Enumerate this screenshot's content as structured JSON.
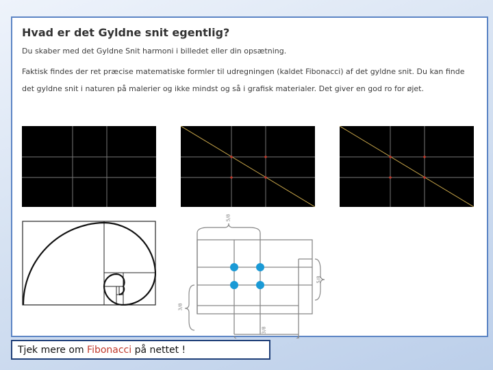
{
  "slide": {
    "heading": "Hvad er det Gyldne snit egentlig?",
    "paragraph_1": "Du skaber med det Gyldne Snit harmoni i billedet eller din opsætning.",
    "paragraph_2": "Faktisk findes der ret præcise matematiske formler til udregningen (kaldet Fibonacci) af det gyldne snit. Du kan finde det gyldne snit i naturen på malerier og ikke mindst og så i grafisk materialer. Det giver en god ro for øjet.",
    "diagram_labels": {
      "top": "5/8",
      "right": "5/8",
      "left": "3/8",
      "bottom": "3/8"
    }
  },
  "caption": {
    "prefix": "Tjek mere om ",
    "link": "Fibonacci",
    "suffix": " på nettet !"
  },
  "colors": {
    "frame_border": "#5b84c4",
    "caption_border": "#1f3f78",
    "link": "#c0392b",
    "dot": "#1a9ad6",
    "diagonal": "#c8a64a",
    "intersection": "#c0392b"
  }
}
